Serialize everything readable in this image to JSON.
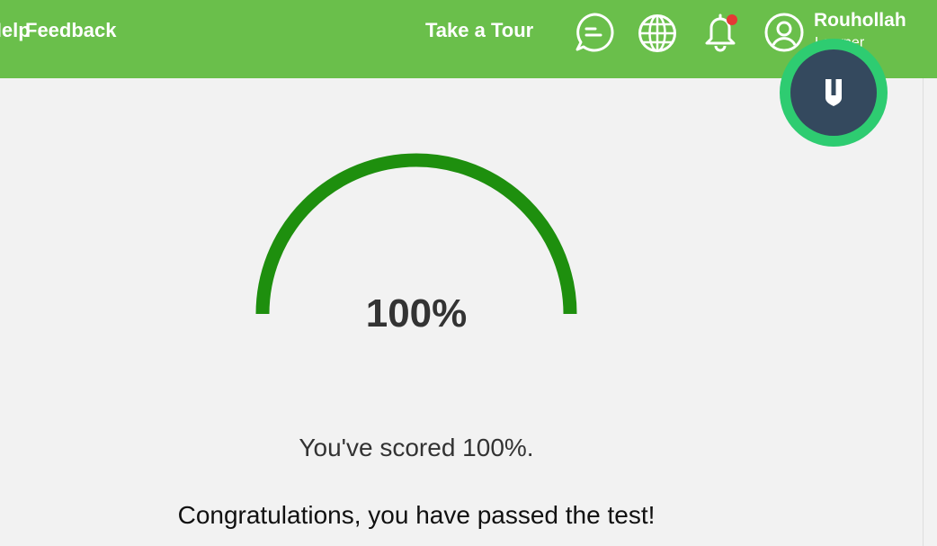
{
  "header": {
    "help_label": "Help",
    "feedback_label": "Feedback",
    "tour_label": "Take a Tour",
    "icons": {
      "chat": "chat-bubble-icon",
      "language": "globe-icon",
      "notifications": "bell-icon",
      "account": "user-avatar-icon"
    },
    "notification_dot_color": "#e53935",
    "user": {
      "name": "Rouhollah",
      "role": "Learner"
    }
  },
  "badge": {
    "icon": "shield-icon",
    "ring_color": "#2ecc71",
    "fill_color": "#34495e"
  },
  "result": {
    "score_fraction": 1.0,
    "score_label": "100%",
    "score_message": "You've scored 100%.",
    "congrats_message": "Congratulations, you have passed the test!",
    "gauge_color": "#1e8f0e"
  },
  "colors": {
    "topbar": "#6abf4b",
    "background": "#f2f2f2"
  }
}
